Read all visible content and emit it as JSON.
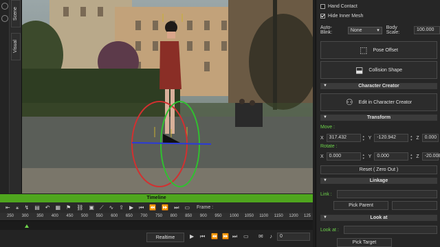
{
  "left_tabs": {
    "scene": "Scene",
    "visual": "Visual"
  },
  "viewport": {
    "ground_color": "#5a5e58"
  },
  "right_panel": {
    "hand_contact": "Hand Contact",
    "hide_inner_mesh": "Hide Inner Mesh",
    "auto_blink_label": "Auto-Blink:",
    "auto_blink_value": "None",
    "body_scale_label": "Body Scale:",
    "body_scale_value": "100.000",
    "pose_offset": "Pose Offset",
    "collision_shape": "Collision Shape",
    "character_creator_header": "Character Creator",
    "edit_in_cc": "Edit in Character Creator",
    "transform_header": "Transform",
    "move_label": "Move :",
    "move": {
      "x": "317.432",
      "y": "-120.942",
      "z": "0.000"
    },
    "rotate_label": "Rotate :",
    "rotate": {
      "x": "0.000",
      "y": "0.000",
      "z": "-20.008"
    },
    "reset": "Reset ( Zero Out )",
    "linkage_header": "Linkage",
    "link_label": "Link :",
    "pick_parent": "Pick Parent",
    "look_at_header": "Look at",
    "look_at_label": "Look at :",
    "pick_target": "Pick Target",
    "x_label": "X",
    "y_label": "Y",
    "z_label": "Z"
  },
  "timeline": {
    "title": "Timeline",
    "frame_label": "Frame :",
    "ticks": [
      "250",
      "300",
      "350",
      "400",
      "450",
      "500",
      "550",
      "600",
      "650",
      "700",
      "750",
      "800",
      "850",
      "900",
      "950",
      "1000",
      "1050",
      "1100",
      "1150",
      "1200",
      "125"
    ],
    "realtime": "Realtime",
    "frame_value": "0"
  }
}
